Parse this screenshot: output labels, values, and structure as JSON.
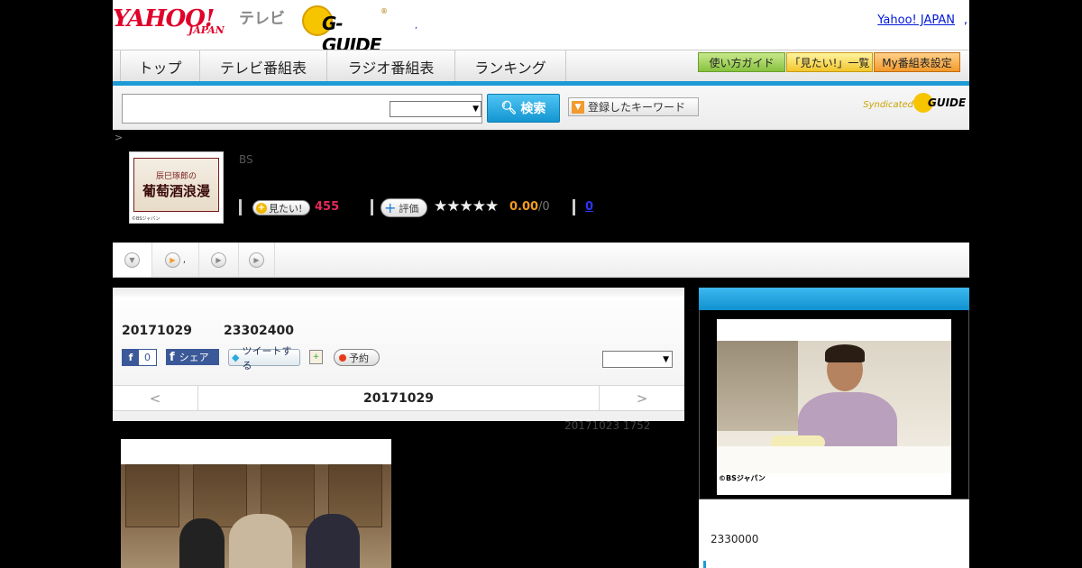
{
  "header": {
    "yahoo_logo": "YAHOO!",
    "japan_logo": "JAPAN",
    "tv_label": "テレビ",
    "gguide_logo": "G-GUIDE",
    "gguide_reg": "®",
    "dot": ",",
    "yahoo_japan_link": "Yahoo! JAPAN",
    "link_dot": ","
  },
  "nav": {
    "tabs": [
      "トップ",
      "テレビ番組表",
      "ラジオ番組表",
      "ランキング"
    ],
    "guide_btn": "使い方ガイド",
    "mitai_list_btn": "「見たい!」一覧",
    "my_schedule_btn": "My番組表設定"
  },
  "search": {
    "query": "",
    "select_value": "",
    "button_label": "検索",
    "keyword_btn": "登録したキーワード",
    "syndicated": "Syndicated",
    "synd_logo": "GUIDE"
  },
  "breadcrumb": ">",
  "program": {
    "thumb_sub": "辰巳琢郎の",
    "thumb_main": "葡萄酒浪漫",
    "thumb_copy": "©BSジャパン",
    "channel": "BS",
    "mitai_label": "見たい!",
    "mitai_count": "455",
    "hyoka_label": "評価",
    "stars": "★★★★★",
    "rating": "0.00",
    "rating_count": "/0",
    "review_count": "0"
  },
  "tabs_row": {
    "tab2_suffix": ","
  },
  "episode": {
    "date": "20171029",
    "time": "23302400",
    "fb_like_count": "0",
    "fb_share": "シェア",
    "tweet": "ツイートする",
    "yoyaku": "予約",
    "select_value": "",
    "nav_prev": "<",
    "nav_date": "20171029",
    "nav_next": ">",
    "updated": "20171023  1752"
  },
  "sidebar": {
    "photo_copy": "©BSジャパン",
    "text": "2330000"
  },
  "colors": {
    "accent_blue": "#1c9bd6",
    "mitai_pink": "#e42a5a",
    "rating_orange": "#f49b1e",
    "yahoo_red": "#e0002a"
  }
}
